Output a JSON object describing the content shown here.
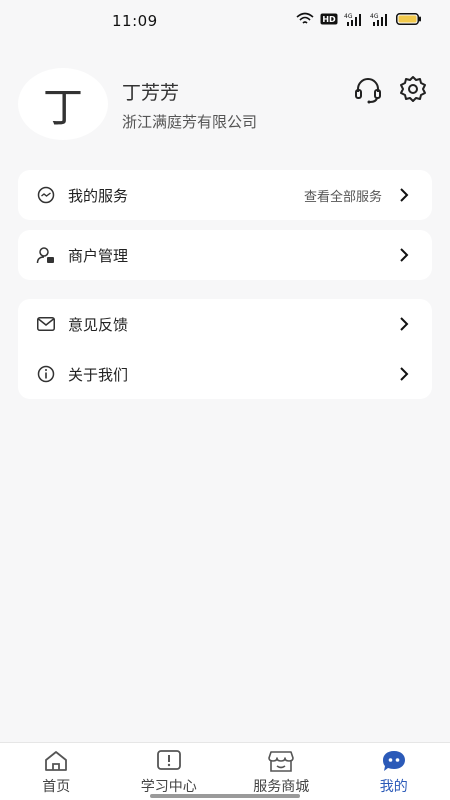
{
  "status_bar": {
    "time": "11:09",
    "hd_label": "HD",
    "net1": "4G",
    "net2": "4G"
  },
  "profile": {
    "avatar_char": "丁",
    "name": "丁芳芳",
    "company": "浙江满庭芳有限公司"
  },
  "menu": {
    "my_services": {
      "label": "我的服务",
      "extra": "查看全部服务"
    },
    "merchant": {
      "label": "商户管理"
    },
    "feedback": {
      "label": "意见反馈"
    },
    "about": {
      "label": "关于我们"
    }
  },
  "tabs": [
    {
      "label": "首页",
      "icon": "home-icon"
    },
    {
      "label": "学习中心",
      "icon": "notice-icon"
    },
    {
      "label": "服务商城",
      "icon": "store-icon"
    },
    {
      "label": "我的",
      "icon": "profile-bubble-icon",
      "active": true
    }
  ],
  "colors": {
    "accent": "#2b5ab8",
    "background": "#f7f7f8",
    "card": "#ffffff"
  }
}
